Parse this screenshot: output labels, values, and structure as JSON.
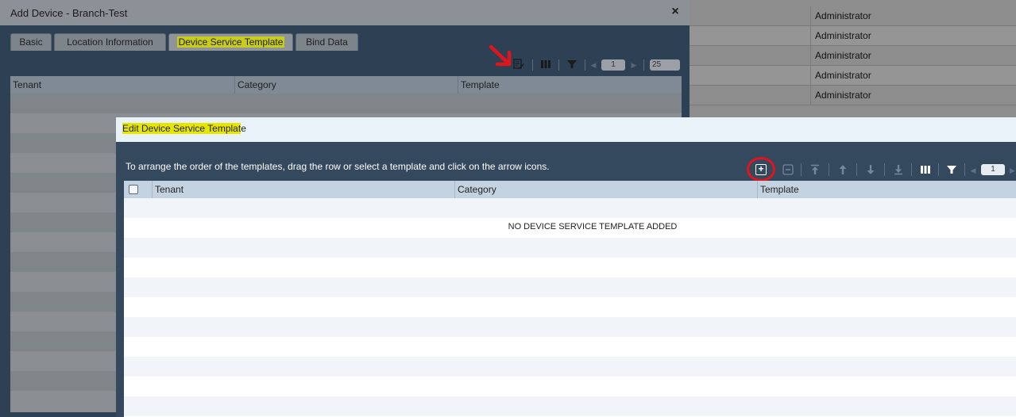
{
  "background": {
    "rows": [
      "Administrator",
      "Administrator",
      "Administrator",
      "Administrator",
      "Administrator"
    ]
  },
  "outer_dialog": {
    "title": "Add Device - Branch-Test",
    "close": "×",
    "tabs": [
      {
        "label": "Basic"
      },
      {
        "label": "Location Information"
      },
      {
        "label": "Device Service Template"
      },
      {
        "label": "Bind Data"
      }
    ],
    "toolbar": {
      "page": "1",
      "page_size": "25"
    },
    "columns": [
      "Tenant",
      "Category",
      "Template"
    ]
  },
  "inner_dialog": {
    "title_highlighted": "Edit Device Service Templat",
    "title_rest": "e",
    "instructions": "To arrange the order of the templates, drag the row or select a template and click on the arrow icons.",
    "toolbar": {
      "page": "1"
    },
    "columns": [
      "Tenant",
      "Category",
      "Template"
    ],
    "empty_message": "NO DEVICE SERVICE TEMPLATE ADDED"
  },
  "colors": {
    "highlight": "#e6e600",
    "annotation": "#e0141c",
    "inner_header": "#34495e"
  }
}
